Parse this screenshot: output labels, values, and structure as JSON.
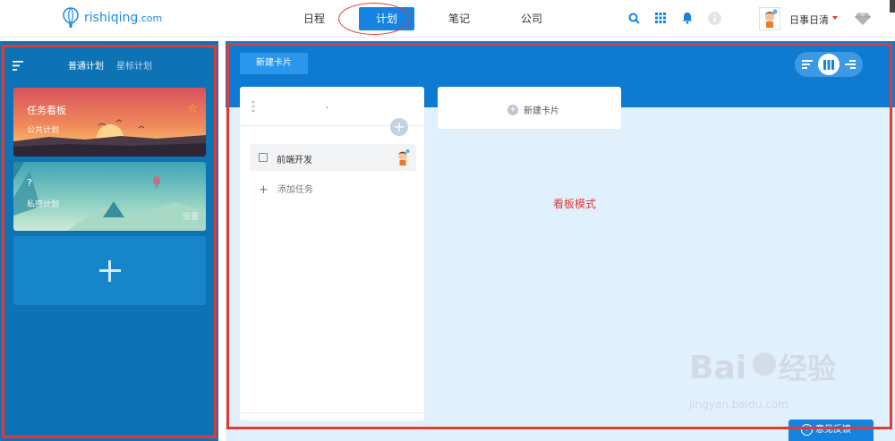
{
  "app": {
    "logo_text": "rishiqing",
    "logo_domain": ".com",
    "brand_color": "#1683e0"
  },
  "nav": {
    "items": [
      {
        "label": "日程",
        "active": false
      },
      {
        "label": "计划",
        "active": true
      },
      {
        "label": "笔记",
        "active": false
      },
      {
        "label": "公司",
        "active": false
      }
    ]
  },
  "header": {
    "icons": [
      "search-icon",
      "grid-icon",
      "bell-icon",
      "info-icon"
    ],
    "username": "日事日清",
    "vip_icon": "diamond-icon"
  },
  "sidebar": {
    "tabs": [
      "普通计划",
      "星标计划"
    ],
    "active_tab": 0,
    "cards": [
      {
        "title": "任务看板",
        "subtitle": "公共计划",
        "starred": true
      },
      {
        "title": "?",
        "subtitle": "私密计划",
        "action": "设置"
      }
    ],
    "add_label": "+"
  },
  "toolbar": {
    "new_card_label": "新建卡片",
    "views": [
      "list-view-icon",
      "kanban-view-icon",
      "timeline-view-icon"
    ],
    "active_view": 1
  },
  "board": {
    "column": {
      "title": ".",
      "tasks": [
        {
          "name": "前端开发",
          "done": false
        }
      ],
      "add_task_label": "添加任务"
    },
    "new_card_column_label": "新建卡片"
  },
  "annotation": {
    "label": "看板模式",
    "color": "#e53935"
  },
  "feedback": {
    "label": "意见反馈"
  },
  "watermark": {
    "text": "Bai du 经验",
    "sub": "jingyan.baidu.com"
  }
}
